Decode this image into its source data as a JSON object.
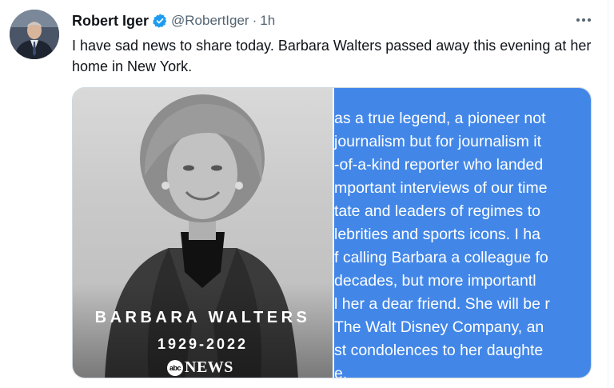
{
  "author": {
    "display_name": "Robert Iger",
    "handle": "@RobertIger",
    "separator": "·",
    "time": "1h",
    "verified": true,
    "verified_color": "#1d9bf0"
  },
  "tweet": {
    "text": "I have sad news to share today. Barbara Walters passed away this evening at her home in New York."
  },
  "media": {
    "photo": {
      "name": "BARBARA WALTERS",
      "years": "1929-2022",
      "logo_abc": "abc",
      "logo_news": "NEWS"
    },
    "quote_card": {
      "background": "#4287e8",
      "lines": [
        "as a true legend, a pioneer not",
        "journalism but for journalism it",
        "-of-a-kind reporter who landed",
        "mportant interviews of our time",
        "tate and leaders of regimes to",
        "lebrities and sports icons. I ha",
        "f calling Barbara a colleague fo",
        " decades, but more importantl",
        "l her a dear friend. She will be r",
        "The Walt Disney Company, an",
        "st condolences to her daughte",
        "e."
      ]
    }
  },
  "icons": {
    "more": "more-options-icon",
    "verified": "verified-badge-icon"
  }
}
